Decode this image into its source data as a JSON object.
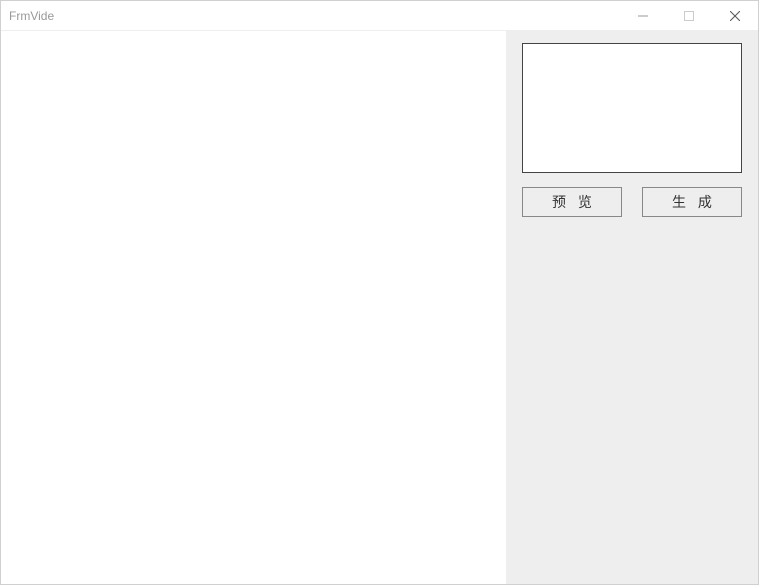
{
  "window": {
    "title": "FrmVide"
  },
  "panel": {
    "buttons": {
      "preview_label": "预 览",
      "generate_label": "生 成"
    }
  }
}
